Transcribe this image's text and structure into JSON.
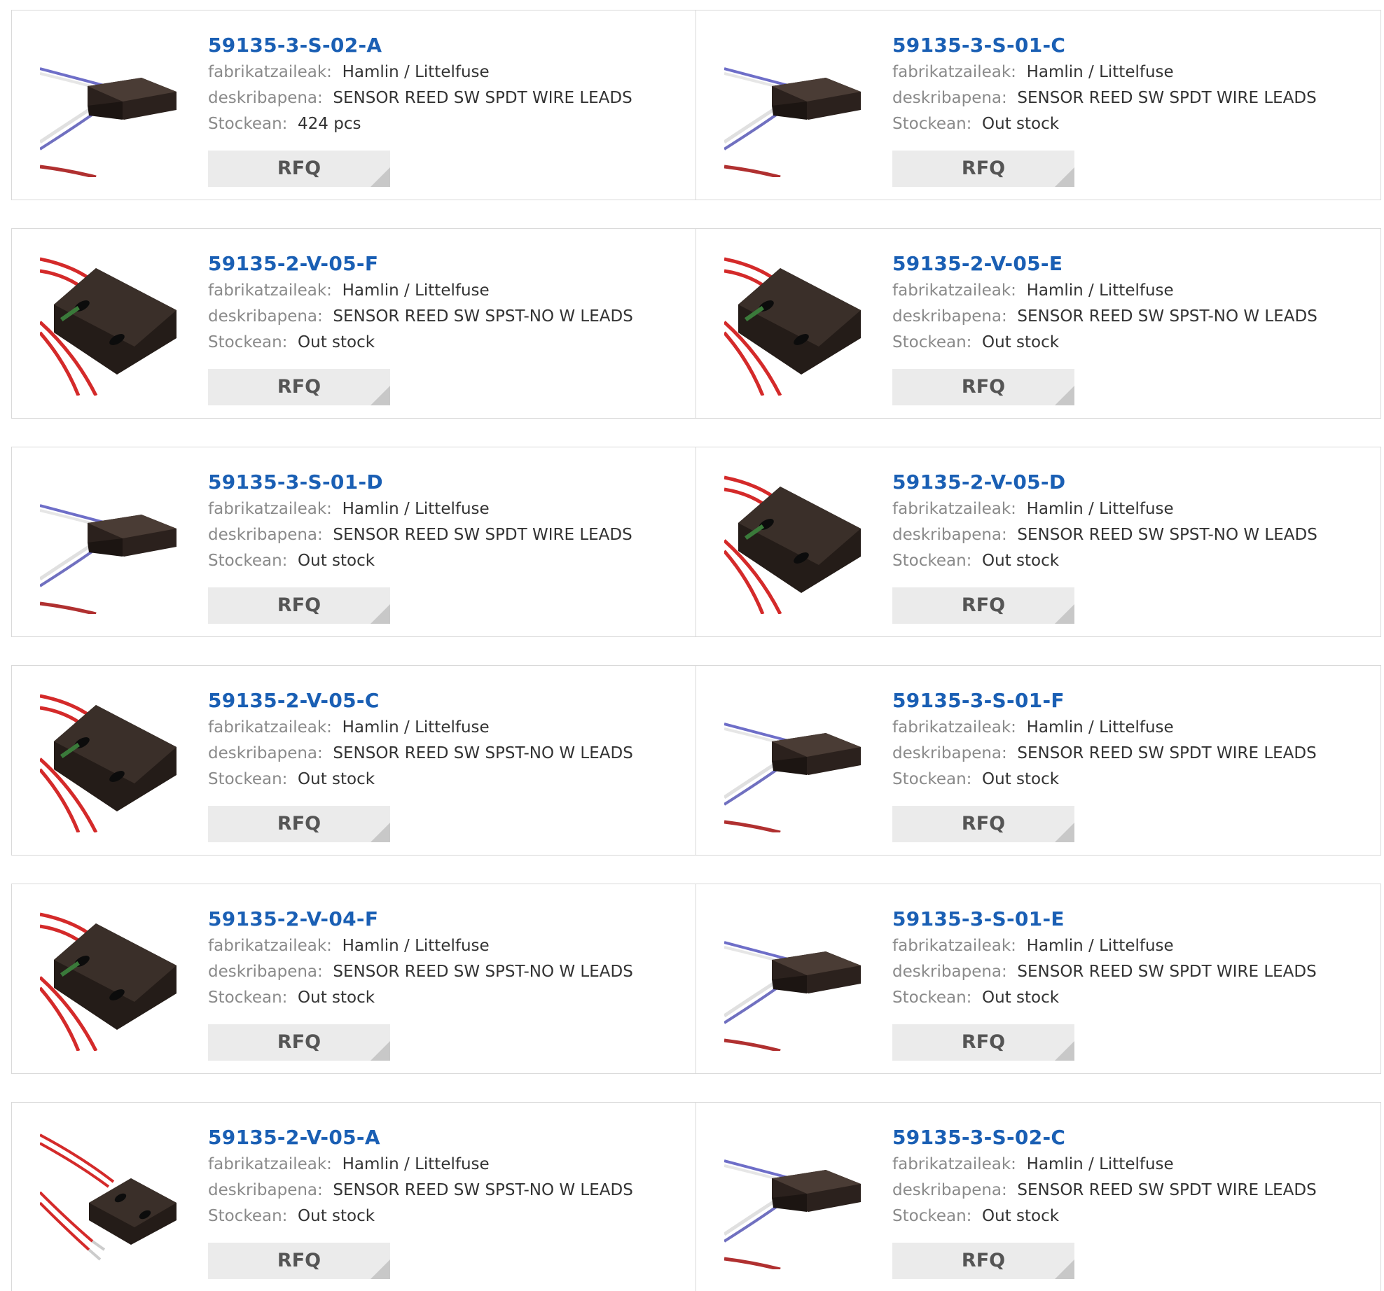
{
  "labels": {
    "manufacturer": "fabrikatzaileak:",
    "description": "deskribapena:",
    "stock": "Stockean:",
    "rfq": "RFQ"
  },
  "products": [
    {
      "part": "59135-3-S-02-A",
      "manufacturer": "Hamlin / Littelfuse",
      "description": "SENSOR REED SW SPDT WIRE LEADS",
      "stock": "424 pcs",
      "image": "flat-sensor-purple-white-wires-icon"
    },
    {
      "part": "59135-3-S-01-C",
      "manufacturer": "Hamlin / Littelfuse",
      "description": "SENSOR REED SW SPDT WIRE LEADS",
      "stock": "Out stock",
      "image": "flat-sensor-purple-white-wires-icon"
    },
    {
      "part": "59135-2-V-05-F",
      "manufacturer": "Hamlin / Littelfuse",
      "description": "SENSOR REED SW SPST-NO W LEADS",
      "stock": "Out stock",
      "image": "block-sensor-red-wires-icon"
    },
    {
      "part": "59135-2-V-05-E",
      "manufacturer": "Hamlin / Littelfuse",
      "description": "SENSOR REED SW SPST-NO W LEADS",
      "stock": "Out stock",
      "image": "block-sensor-red-wires-icon"
    },
    {
      "part": "59135-3-S-01-D",
      "manufacturer": "Hamlin / Littelfuse",
      "description": "SENSOR REED SW SPDT WIRE LEADS",
      "stock": "Out stock",
      "image": "flat-sensor-purple-white-wires-icon"
    },
    {
      "part": "59135-2-V-05-D",
      "manufacturer": "Hamlin / Littelfuse",
      "description": "SENSOR REED SW SPST-NO W LEADS",
      "stock": "Out stock",
      "image": "block-sensor-red-wires-icon"
    },
    {
      "part": "59135-2-V-05-C",
      "manufacturer": "Hamlin / Littelfuse",
      "description": "SENSOR REED SW SPST-NO W LEADS",
      "stock": "Out stock",
      "image": "block-sensor-red-wires-icon"
    },
    {
      "part": "59135-3-S-01-F",
      "manufacturer": "Hamlin / Littelfuse",
      "description": "SENSOR REED SW SPDT WIRE LEADS",
      "stock": "Out stock",
      "image": "flat-sensor-purple-white-wires-icon"
    },
    {
      "part": "59135-2-V-04-F",
      "manufacturer": "Hamlin / Littelfuse",
      "description": "SENSOR REED SW SPST-NO W LEADS",
      "stock": "Out stock",
      "image": "block-sensor-red-wires-icon"
    },
    {
      "part": "59135-3-S-01-E",
      "manufacturer": "Hamlin / Littelfuse",
      "description": "SENSOR REED SW SPDT WIRE LEADS",
      "stock": "Out stock",
      "image": "flat-sensor-purple-white-wires-icon"
    },
    {
      "part": "59135-2-V-05-A",
      "manufacturer": "Hamlin / Littelfuse",
      "description": "SENSOR REED SW SPST-NO W LEADS",
      "stock": "Out stock",
      "image": "small-sensor-red-wires-icon"
    },
    {
      "part": "59135-3-S-02-C",
      "manufacturer": "Hamlin / Littelfuse",
      "description": "SENSOR REED SW SPDT WIRE LEADS",
      "stock": "Out stock",
      "image": "flat-sensor-purple-white-wires-icon"
    }
  ],
  "colors": {
    "part_link": "#1a5fb4",
    "label_gray": "#8a8a8a",
    "border": "#d9d9d9",
    "rfq_bg": "#ebebeb"
  }
}
